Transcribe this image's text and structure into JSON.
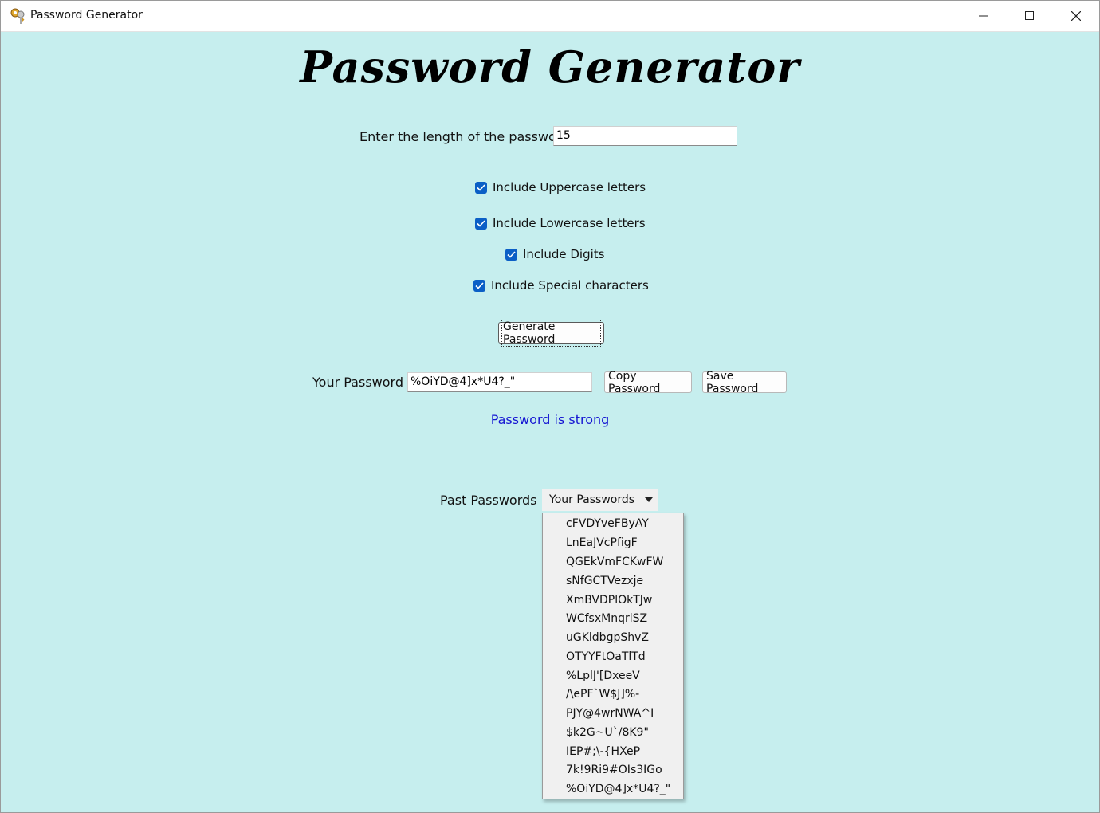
{
  "window": {
    "title": "Password Generator",
    "icon": "keys-icon"
  },
  "heading": "Password Generator",
  "length": {
    "label": "Enter the length of the password",
    "value": "15"
  },
  "options": [
    {
      "label": "Include Uppercase letters",
      "checked": true
    },
    {
      "label": "Include Lowercase letters",
      "checked": true
    },
    {
      "label": "Include Digits",
      "checked": true
    },
    {
      "label": "Include Special characters",
      "checked": true
    }
  ],
  "generate_button": "Generate Password",
  "result": {
    "label": "Your Password",
    "value": "%OiYD@4]x*U4?_\"",
    "copy_button": "Copy Password",
    "save_button": "Save Password",
    "strength": "Password is strong",
    "strength_color": "#1414d2"
  },
  "past": {
    "label": "Past Passwords",
    "selected": "Your Passwords",
    "items": [
      "cFVDYveFByAY",
      "LnEaJVcPfigF",
      "QGEkVmFCKwFW",
      "sNfGCTVezxje",
      "XmBVDPlOkTJw",
      "WCfsxMnqrlSZ",
      "uGKldbgpShvZ",
      "OTYYFtOaTlTd",
      "%LplJ'[DxeeV",
      "/\\ePF`W$J]%-",
      "PJY@4wrNWA^I",
      "$k2G~U`/8K9\"",
      "IEP#;\\-{HXeP",
      "7k!9Ri9#OIs3IGo",
      "%OiYD@4]x*U4?_\""
    ]
  },
  "colors": {
    "background": "#c6eeee",
    "checkbox": "#0b5fc6"
  }
}
